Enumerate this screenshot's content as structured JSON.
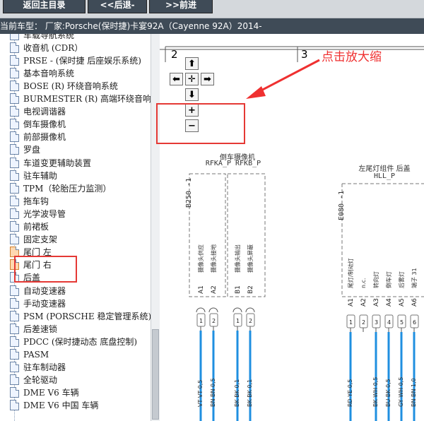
{
  "toolbar": {
    "home_label": "返回主目录",
    "back_label": "<<后退-",
    "forward_label": ">>前进"
  },
  "vehicle_info": "当前车型： 厂家:Porsche(保时捷)卡宴92A（Cayenne 92A）2014-",
  "sidebar": {
    "items": [
      {
        "label": "车载导航系统"
      },
      {
        "label": "收音机 (CDR）"
      },
      {
        "label": "PRSE - (保时捷 后座娱乐系统)"
      },
      {
        "label": "基本音响系统"
      },
      {
        "label": "BOSE (R) 环绕音响系统"
      },
      {
        "label": "BURMESTER (R) 高端环绕音响系统"
      },
      {
        "label": "电视调谐器"
      },
      {
        "label": "倒车摄像机"
      },
      {
        "label": "前部摄像机"
      },
      {
        "label": "罗盘"
      },
      {
        "label": "车道变更辅助装置"
      },
      {
        "label": "驻车辅助"
      },
      {
        "label": "TPM（轮胎压力监测）"
      },
      {
        "label": "拖车钩"
      },
      {
        "label": "光学波导管"
      },
      {
        "label": "前裙板"
      },
      {
        "label": "固定支架"
      },
      {
        "label": "尾门 左"
      },
      {
        "label": "尾门 右"
      },
      {
        "label": "后盖"
      },
      {
        "label": "自动变速器"
      },
      {
        "label": "手动变速器"
      },
      {
        "label": "PSM (PORSCHE 稳定管理系统)"
      },
      {
        "label": "后差速锁"
      },
      {
        "label": "PDCC (保时捷动态 底盘控制)"
      },
      {
        "label": "PASM"
      },
      {
        "label": "驻车制动器"
      },
      {
        "label": "全轮驱动"
      },
      {
        "label": "DME V6 车辆"
      },
      {
        "label": "DME V6 中国 车辆"
      }
    ]
  },
  "annotation": {
    "callout_text": "点击放大缩",
    "color": "#ef3030"
  },
  "zoom_controls": {
    "up": "⬆",
    "left": "⬅",
    "center": "✛",
    "right": "➡",
    "down": "⬇",
    "zoom_in": "+",
    "zoom_out": "−"
  },
  "diagram": {
    "grid_col_2": "2",
    "grid_col_3": "3",
    "camera": {
      "title_cn": "倒车摄像机",
      "title_codes": "RFKA_P RFKB_P",
      "ref": "B250 -1",
      "descs": [
        "摄像头供应",
        "摄像头接地",
        "摄像头输出",
        "摄像头屏蔽"
      ],
      "pins": [
        "A1",
        "A2",
        "B1",
        "B2"
      ],
      "connectors": [
        "1",
        "2",
        "1",
        "2"
      ],
      "wires": [
        "VT VT 0,5",
        "BN BN 0,5",
        "BK BK 0,1",
        "BK BK 0,1"
      ]
    },
    "taillight": {
      "title_cn": "左尾灯组件 后盖",
      "title_code": "HLL_P",
      "ref": "E080 -1",
      "descs": [
        "尾灯/制动灯",
        "n.c.",
        "转向灯",
        "倒车灯",
        "后雾灯",
        "端子 31"
      ],
      "pins": [
        "A1",
        "A2",
        "A3",
        "A4",
        "A5",
        "A6"
      ],
      "connectors": [
        "1",
        "2",
        "3",
        "4",
        "5",
        "6"
      ],
      "wires": [
        "RD YE 0,5",
        "BK WH 0,5",
        "BU BK 0,5",
        "GY WH 0,5",
        "BN BN 1,0"
      ]
    }
  }
}
